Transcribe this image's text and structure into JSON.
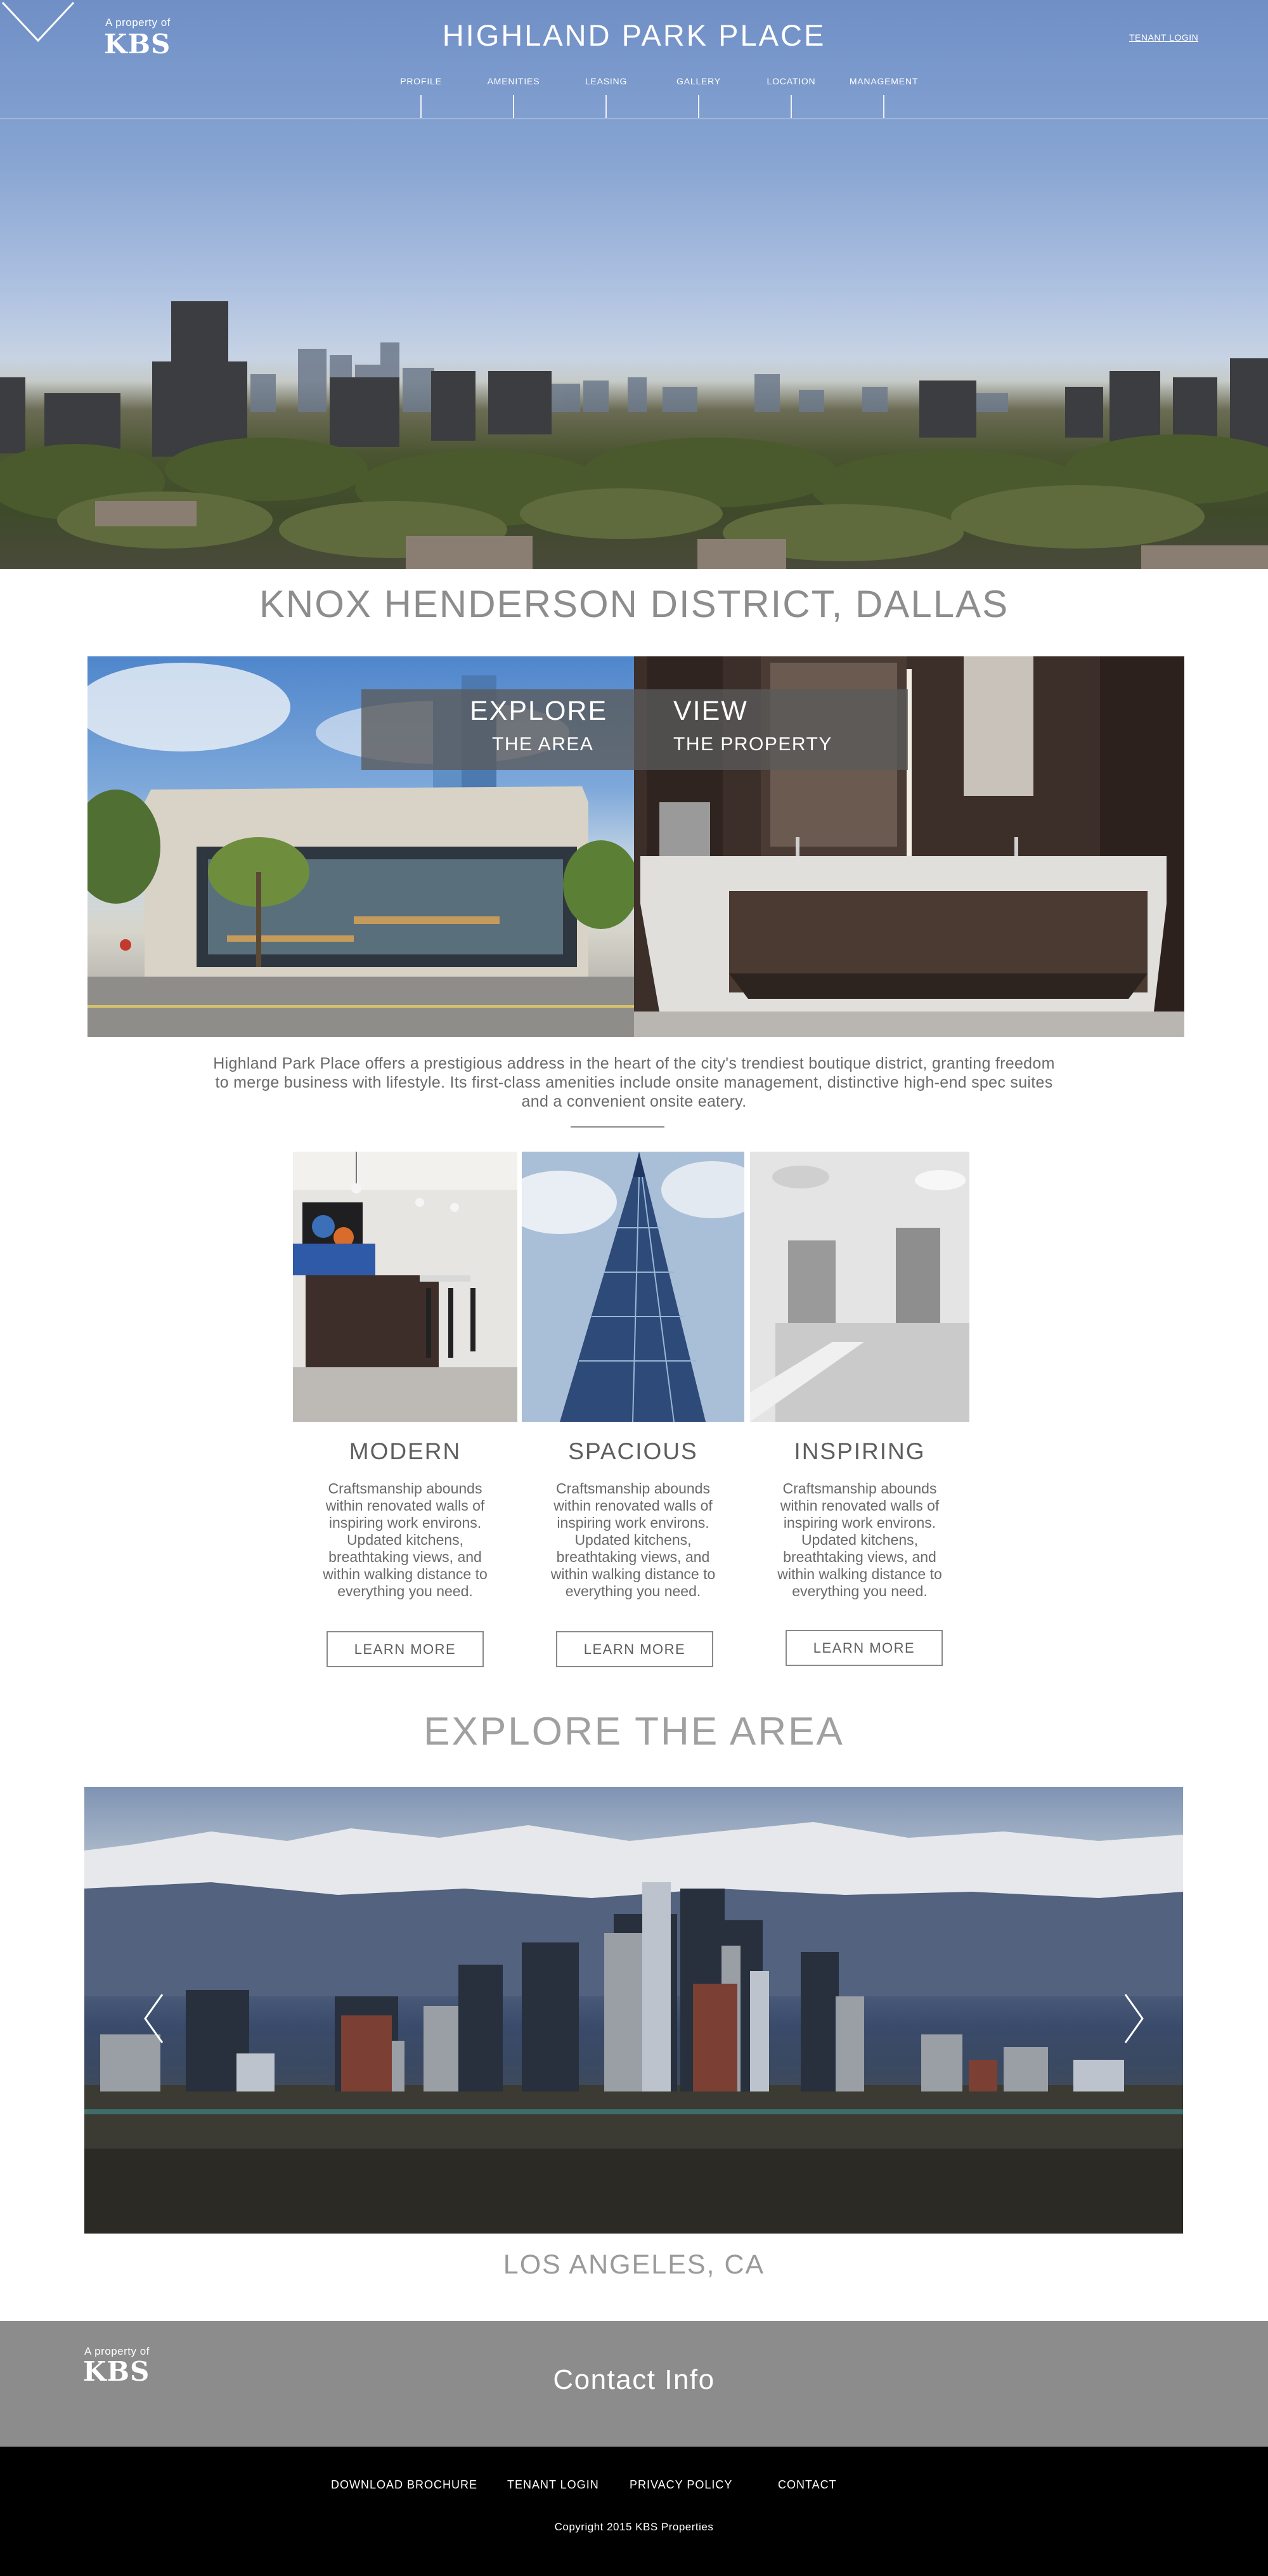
{
  "brand": {
    "small": "A property of",
    "logo": "KBS"
  },
  "header": {
    "title": "HIGHLAND PARK PLACE",
    "tenant_login": "TENANT LOGIN",
    "nav": [
      "PROFILE",
      "AMENITIES",
      "LEASING",
      "GALLERY",
      "LOCATION",
      "MANAGEMENT"
    ]
  },
  "district": {
    "title": "KNOX HENDERSON DISTRICT, DALLAS",
    "explore": {
      "big": "EXPLORE",
      "small": "THE AREA"
    },
    "view": {
      "big": "VIEW",
      "small": "THE PROPERTY"
    },
    "intro": "Highland Park Place offers a prestigious address in the heart of the city's trendiest boutique district, granting freedom to merge business with lifestyle. Its first-class amenities include onsite management, distinctive high-end spec suites and a convenient onsite eatery."
  },
  "features": [
    {
      "title": "MODERN",
      "body": [
        "Craftsmanship abounds",
        "within renovated walls of",
        "inspiring work environs.",
        "Updated kitchens,",
        "breathtaking views, and",
        "within walking distance to",
        "everything you need."
      ],
      "button": "LEARN MORE"
    },
    {
      "title": "SPACIOUS",
      "body": [
        "Craftsmanship abounds",
        "within renovated walls of",
        "inspiring work environs.",
        "Updated kitchens,",
        "breathtaking views, and",
        "within walking distance to",
        "everything you need."
      ],
      "button": "LEARN MORE"
    },
    {
      "title": "INSPIRING",
      "body": [
        "Craftsmanship abounds",
        "within renovated walls of",
        "inspiring work environs.",
        "Updated kitchens,",
        "breathtaking views, and",
        "within walking distance to",
        "everything you need."
      ],
      "button": "LEARN MORE"
    }
  ],
  "area": {
    "title": "EXPLORE THE AREA",
    "caption": "LOS ANGELES, CA"
  },
  "footer": {
    "contact_title": "Contact Info",
    "links": [
      "DOWNLOAD BROCHURE",
      "TENANT LOGIN",
      "PRIVACY POLICY",
      "CONTACT"
    ],
    "copyright": "Copyright 2015 KBS Properties"
  },
  "icons": {
    "down": "chevron-down-icon",
    "prev": "chevron-left-icon",
    "next": "chevron-right-icon"
  }
}
